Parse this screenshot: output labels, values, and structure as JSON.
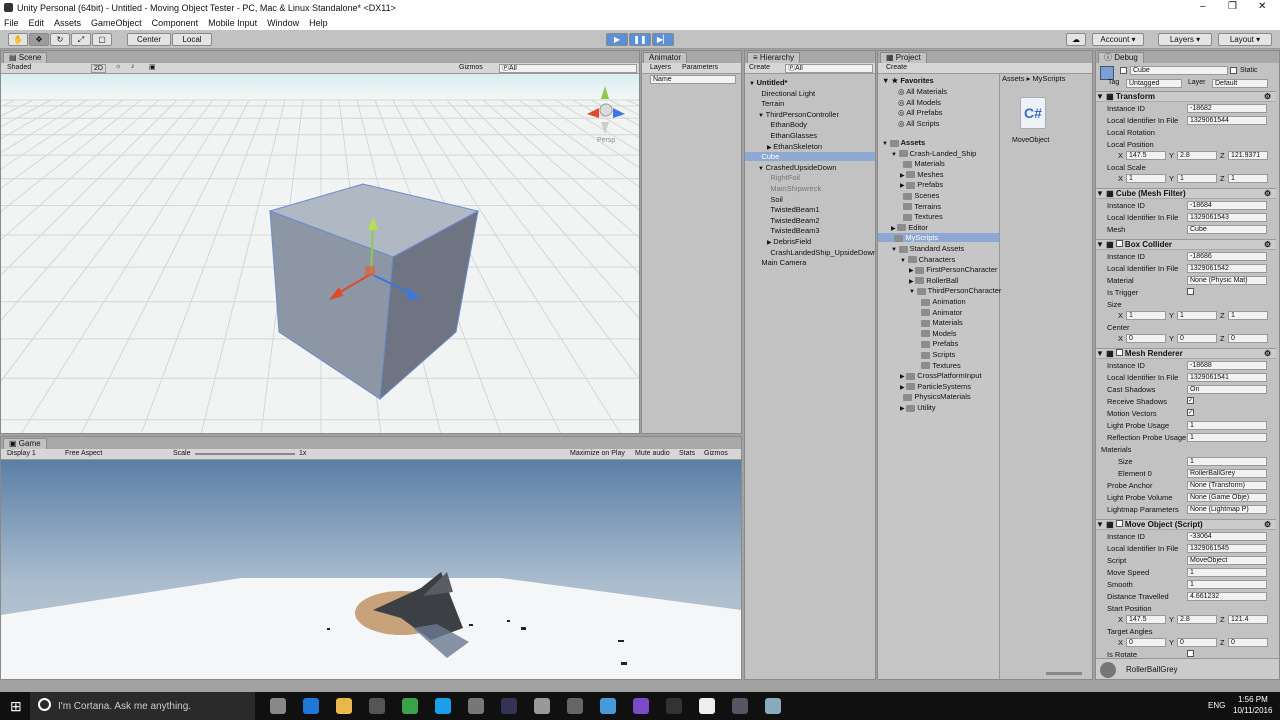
{
  "window": {
    "title": "Unity Personal (64bit) - Untitled - Moving Object Tester - PC, Mac & Linux Standalone* <DX11>"
  },
  "menu": [
    "File",
    "Edit",
    "Assets",
    "GameObject",
    "Component",
    "Mobile Input",
    "Window",
    "Help"
  ],
  "toolbar": {
    "center": "Center",
    "local": "Local",
    "account": "Account",
    "layers": "Layers",
    "layout": "Layout"
  },
  "scene": {
    "tab": "Scene",
    "shading": "Shaded",
    "mode2d": "2D",
    "gizmos": "Gizmos",
    "search": "ⓅAll",
    "persp": "Persp"
  },
  "animator": {
    "tab": "Animator",
    "layers": "Layers",
    "parameters": "Parameters",
    "search": "Name"
  },
  "hierarchy": {
    "tab": "Hierarchy",
    "create": "Create",
    "search": "ⓅAll",
    "items": [
      {
        "label": "Untitled*",
        "level": 0,
        "arrow": "▼",
        "style": "bold"
      },
      {
        "label": "Directional Light",
        "level": 1,
        "arrow": "",
        "style": ""
      },
      {
        "label": "Terrain",
        "level": 1,
        "arrow": "",
        "style": ""
      },
      {
        "label": "ThirdPersonController",
        "level": 1,
        "arrow": "▼",
        "style": ""
      },
      {
        "label": "EthanBody",
        "level": 2,
        "arrow": "",
        "style": ""
      },
      {
        "label": "EthanGlasses",
        "level": 2,
        "arrow": "",
        "style": ""
      },
      {
        "label": "EthanSkeleton",
        "level": 2,
        "arrow": "▶",
        "style": ""
      },
      {
        "label": "Cube",
        "level": 1,
        "arrow": "",
        "style": "selected"
      },
      {
        "label": "CrashedUpsideDown",
        "level": 1,
        "arrow": "▼",
        "style": ""
      },
      {
        "label": "RightFoil",
        "level": 2,
        "arrow": "",
        "style": "grey"
      },
      {
        "label": "MainShipwreck",
        "level": 2,
        "arrow": "",
        "style": "grey"
      },
      {
        "label": "Soil",
        "level": 2,
        "arrow": "",
        "style": ""
      },
      {
        "label": "TwistedBeam1",
        "level": 2,
        "arrow": "",
        "style": ""
      },
      {
        "label": "TwistedBeam2",
        "level": 2,
        "arrow": "",
        "style": ""
      },
      {
        "label": "TwistedBeam3",
        "level": 2,
        "arrow": "",
        "style": ""
      },
      {
        "label": "DebrisField",
        "level": 2,
        "arrow": "▶",
        "style": ""
      },
      {
        "label": "CrashLandedShip_UpsideDown",
        "level": 2,
        "arrow": "",
        "style": ""
      },
      {
        "label": "Main Camera",
        "level": 1,
        "arrow": "",
        "style": ""
      }
    ]
  },
  "project": {
    "tab": "Project",
    "create": "Create",
    "breadcrumb": "Assets ▸ MyScripts",
    "asset": "MoveObject",
    "favorites_label": "Favorites",
    "favorites": [
      "All Materials",
      "All Models",
      "All Prefabs",
      "All Scripts"
    ],
    "tree": [
      {
        "label": "Assets",
        "level": 0,
        "arrow": "▼",
        "style": "bold"
      },
      {
        "label": "Crash-Landed_Ship",
        "level": 1,
        "arrow": "▼",
        "style": ""
      },
      {
        "label": "Materials",
        "level": 2,
        "arrow": "",
        "style": ""
      },
      {
        "label": "Meshes",
        "level": 2,
        "arrow": "▶",
        "style": ""
      },
      {
        "label": "Prefabs",
        "level": 2,
        "arrow": "▶",
        "style": ""
      },
      {
        "label": "Scenes",
        "level": 2,
        "arrow": "",
        "style": ""
      },
      {
        "label": "Terrains",
        "level": 2,
        "arrow": "",
        "style": ""
      },
      {
        "label": "Textures",
        "level": 2,
        "arrow": "",
        "style": ""
      },
      {
        "label": "Editor",
        "level": 1,
        "arrow": "▶",
        "style": ""
      },
      {
        "label": "MyScripts",
        "level": 1,
        "arrow": "",
        "style": "selected"
      },
      {
        "label": "Standard Assets",
        "level": 1,
        "arrow": "▼",
        "style": ""
      },
      {
        "label": "Characters",
        "level": 2,
        "arrow": "▼",
        "style": ""
      },
      {
        "label": "FirstPersonCharacter",
        "level": 3,
        "arrow": "▶",
        "style": ""
      },
      {
        "label": "RollerBall",
        "level": 3,
        "arrow": "▶",
        "style": ""
      },
      {
        "label": "ThirdPersonCharacter",
        "level": 3,
        "arrow": "▼",
        "style": ""
      },
      {
        "label": "Animation",
        "level": 4,
        "arrow": "",
        "style": ""
      },
      {
        "label": "Animator",
        "level": 4,
        "arrow": "",
        "style": ""
      },
      {
        "label": "Materials",
        "level": 4,
        "arrow": "",
        "style": ""
      },
      {
        "label": "Models",
        "level": 4,
        "arrow": "",
        "style": ""
      },
      {
        "label": "Prefabs",
        "level": 4,
        "arrow": "",
        "style": ""
      },
      {
        "label": "Scripts",
        "level": 4,
        "arrow": "",
        "style": ""
      },
      {
        "label": "Textures",
        "level": 4,
        "arrow": "",
        "style": ""
      },
      {
        "label": "CrossPlatformInput",
        "level": 2,
        "arrow": "▶",
        "style": ""
      },
      {
        "label": "ParticleSystems",
        "level": 2,
        "arrow": "▶",
        "style": ""
      },
      {
        "label": "PhysicsMaterials",
        "level": 2,
        "arrow": "",
        "style": ""
      },
      {
        "label": "Utility",
        "level": 2,
        "arrow": "▶",
        "style": ""
      }
    ]
  },
  "debug": {
    "tab": "Debug",
    "name": "Cube",
    "static": "Static",
    "tag_label": "Tag",
    "tag": "Untagged",
    "layer_label": "Layer",
    "layer": "Default",
    "transform": {
      "title": "Transform",
      "instance_label": "Instance ID",
      "instance": "-18682",
      "lid_label": "Local Identifier In File",
      "lid": "1329061544",
      "rotation": "Local Rotation",
      "position": "Local Position",
      "px": "147.5",
      "py": "2.8",
      "pz": "121.9371",
      "scale": "Local Scale",
      "sx": "1",
      "sy": "1",
      "sz": "1"
    },
    "mesh_filter": {
      "title": "Cube (Mesh Filter)",
      "instance": "-18684",
      "lid": "1329061543",
      "mesh_label": "Mesh",
      "mesh": "Cube"
    },
    "box_collider": {
      "title": "Box Collider",
      "instance": "-18686",
      "lid": "1329061542",
      "material_label": "Material",
      "material": "None (Physic Mat)",
      "trigger": "Is Trigger",
      "size": "Size",
      "szx": "1",
      "szy": "1",
      "szz": "1",
      "center": "Center",
      "cx": "0",
      "cy": "0",
      "cz": "0"
    },
    "mesh_renderer": {
      "title": "Mesh Renderer",
      "instance": "-18688",
      "lid": "1329061541",
      "cast_label": "Cast Shadows",
      "cast": "On",
      "receive": "Receive Shadows",
      "motion": "Motion Vectors",
      "lpu_label": "Light Probe Usage",
      "lpu": "1",
      "rpu_label": "Reflection Probe Usage",
      "rpu": "1",
      "materials": "Materials",
      "size_label": "Size",
      "size": "1",
      "el_label": "Element 0",
      "el": "RollerBallGrey",
      "anchor_label": "Probe Anchor",
      "anchor": "None (Transform)",
      "lpv_label": "Light Probe Volume",
      "lpv": "None (Game Obje)",
      "lmp_label": "Lightmap Parameters",
      "lmp": "None (Lightmap P)"
    },
    "move_object": {
      "title": "Move Object (Script)",
      "instance": "-33064",
      "lid": "1329061545",
      "script_label": "Script",
      "script": "MoveObject",
      "speed_label": "Move Speed",
      "speed": "1",
      "smooth_label": "Smooth",
      "smooth": "1",
      "dist_label": "Distance Travelled",
      "dist": "4.661232",
      "start_label": "Start Position",
      "stx": "147.5",
      "sty": "2.8",
      "stz": "121.4",
      "angles_label": "Target Angles",
      "ax": "0",
      "ay": "0",
      "az": "0",
      "rotate_label": "Is Rotate"
    },
    "footer": "RollerBallGrey"
  },
  "game": {
    "tab": "Game",
    "display": "Display 1",
    "aspect": "Free Aspect",
    "scale_label": "Scale",
    "scale": "1x",
    "maximize": "Maximize on Play",
    "mute": "Mute audio",
    "stats": "Stats",
    "gizmos": "Gizmos"
  },
  "taskbar": {
    "cortana": "I'm Cortana. Ask me anything.",
    "lang": "ENG",
    "time": "1:56 PM",
    "date": "10/11/2016"
  }
}
